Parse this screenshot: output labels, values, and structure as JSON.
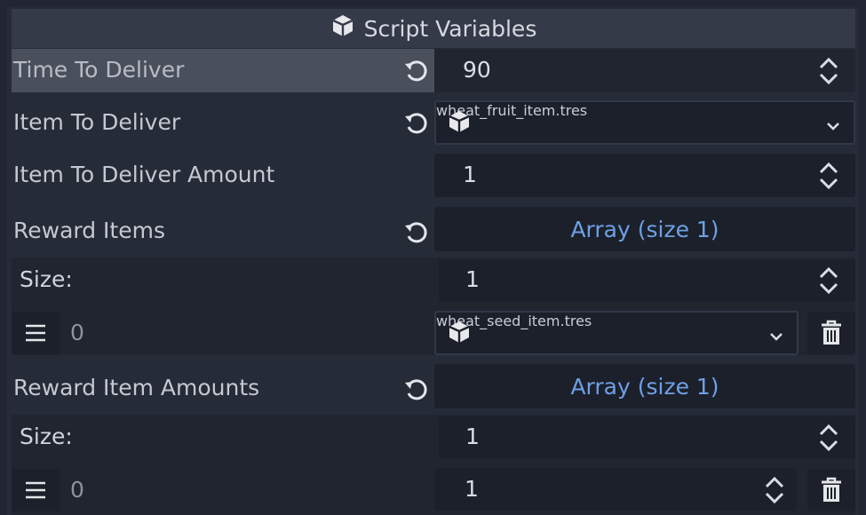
{
  "section": {
    "title": "Script Variables",
    "icon": "cube-icon"
  },
  "time_to_deliver": {
    "label": "Time To Deliver",
    "value": "90"
  },
  "item_to_deliver": {
    "label": "Item To Deliver",
    "value": "wheat_fruit_item.tres"
  },
  "item_amount": {
    "label": "Item To Deliver Amount",
    "value": "1"
  },
  "reward_items": {
    "label": "Reward Items",
    "array_label": "Array (size 1)",
    "size_label": "Size:",
    "size_value": "1",
    "entries": [
      {
        "index": "0",
        "value": "wheat_seed_item.tres"
      }
    ]
  },
  "reward_amounts": {
    "label": "Reward Item Amounts",
    "array_label": "Array (size 1)",
    "size_label": "Size:",
    "size_value": "1",
    "entries": [
      {
        "index": "0",
        "value": "1"
      }
    ]
  },
  "colors": {
    "accent": "#6ea0e6",
    "background": "#262b38",
    "field": "#1c202a",
    "highlight": "#4a4f5c"
  }
}
